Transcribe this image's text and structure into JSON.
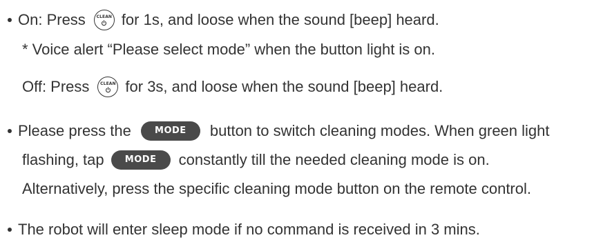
{
  "on": {
    "prefix": "On: Press",
    "suffix": "for 1s, and loose when the sound [beep] heard.",
    "note": "* Voice alert “Please select mode” when the button light is on."
  },
  "off": {
    "prefix": "Off: Press",
    "suffix": "for 3s, and loose when the sound [beep] heard."
  },
  "icons": {
    "clean_label": "CLEAN",
    "clean_icon": "power-icon"
  },
  "mode": {
    "button_label": "MODE",
    "line1_before": "Please press the",
    "line1_after": "button to switch cleaning modes. When green light",
    "line2_before": "flashing, tap",
    "line2_after": "constantly till the needed cleaning mode is on.",
    "line3": "Alternatively, press the specific cleaning mode button on the remote control."
  },
  "sleep": {
    "text": "The robot will enter sleep mode if no command is received in 3 mins."
  }
}
